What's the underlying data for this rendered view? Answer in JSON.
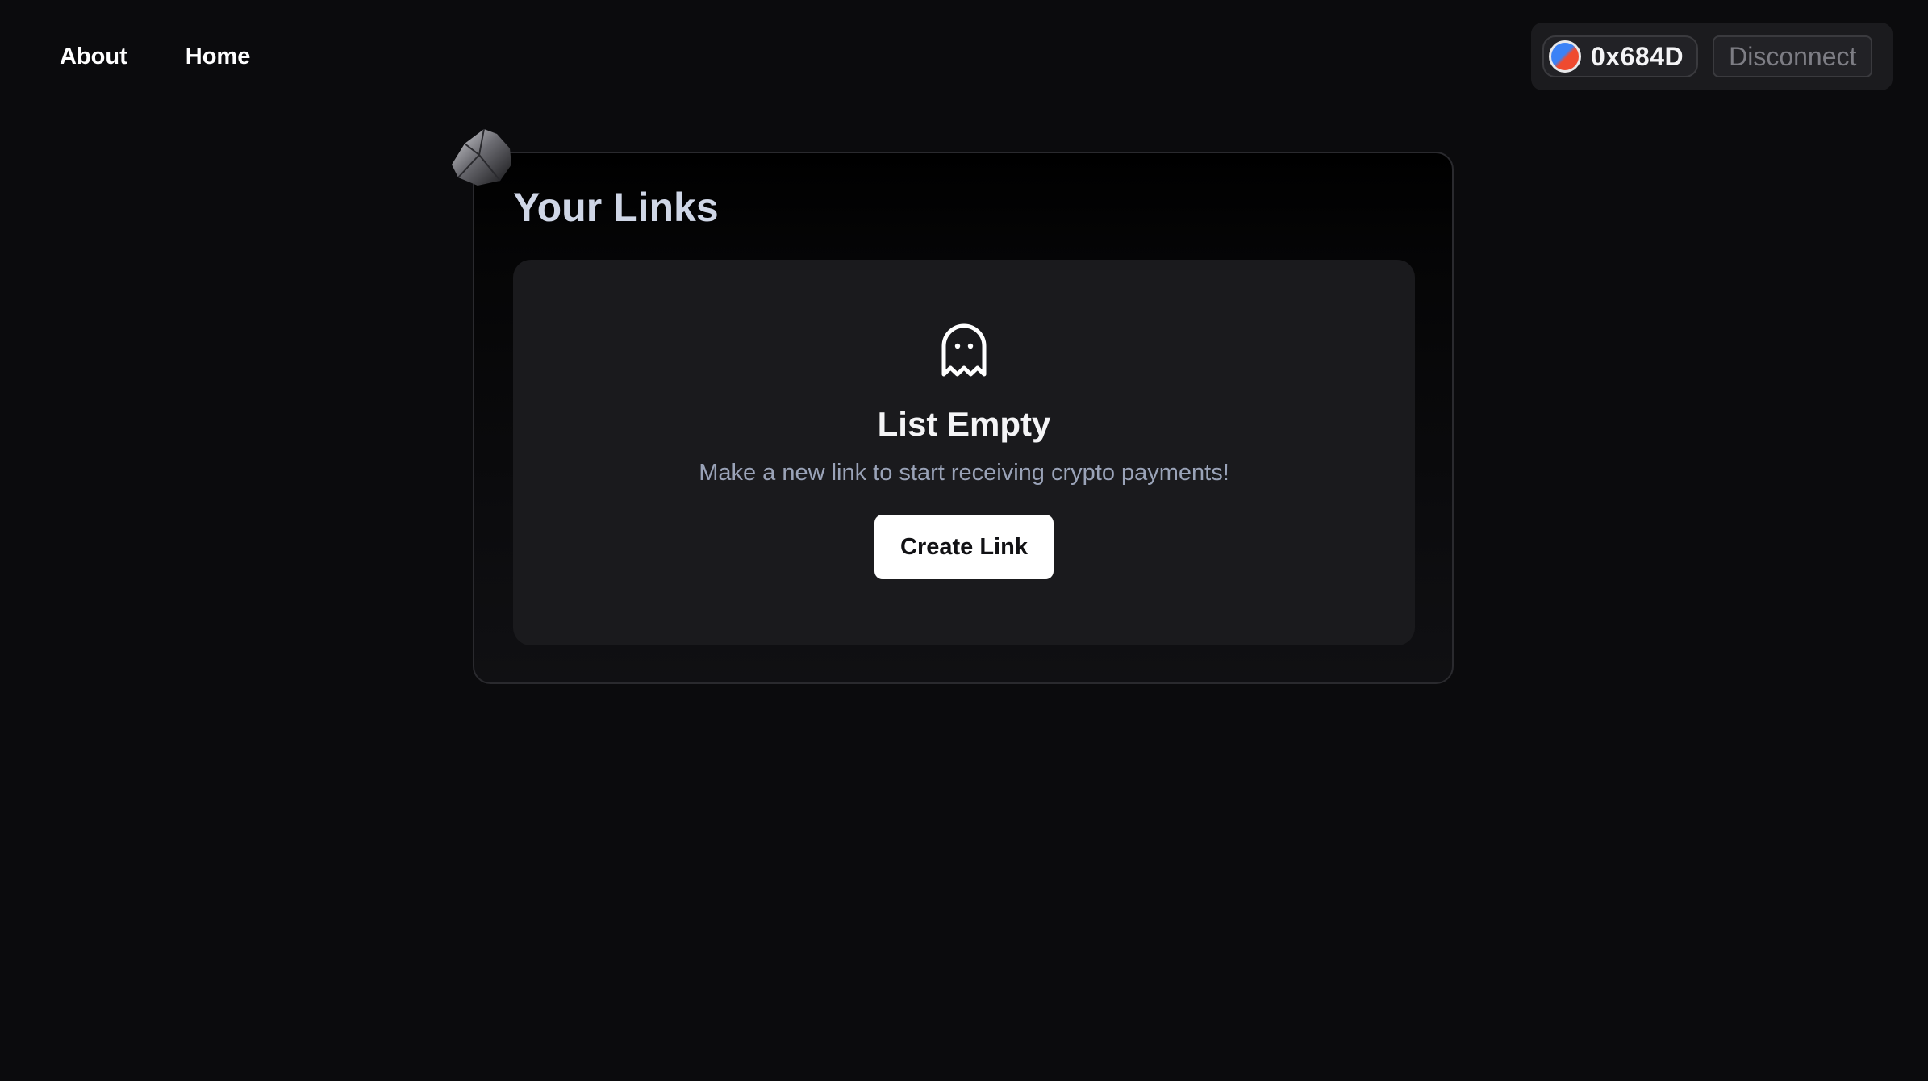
{
  "nav": {
    "links": [
      {
        "label": "About"
      },
      {
        "label": "Home"
      }
    ]
  },
  "wallet": {
    "address": "0x684D",
    "avatar_colors": [
      "#3b82f6",
      "#ef4a2f"
    ],
    "disconnect_label": "Disconnect"
  },
  "links_card": {
    "title": "Your Links",
    "empty_state": {
      "icon": "ghost-icon",
      "title": "List Empty",
      "subtitle": "Make a new link to start receiving crypto payments!",
      "button_label": "Create Link"
    }
  },
  "decoration": {
    "icon": "rock-icon"
  }
}
